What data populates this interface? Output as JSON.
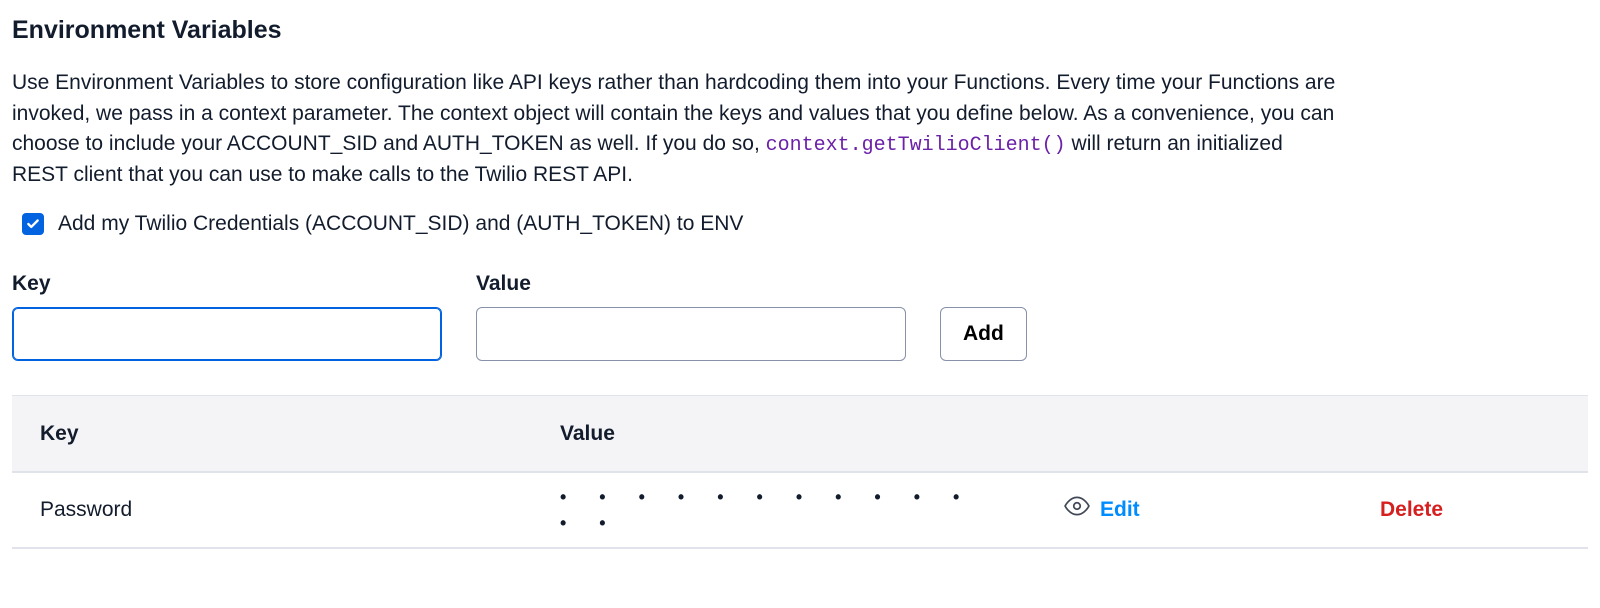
{
  "section": {
    "title": "Environment Variables",
    "description_before_code": "Use Environment Variables to store configuration like API keys rather than hardcoding them into your Functions. Every time your Functions are invoked, we pass in a context parameter. The context object will contain the keys and values that you define below. As a convenience, you can choose to include your ACCOUNT_SID and AUTH_TOKEN as well. If you do so, ",
    "code_snippet": "context.getTwilioClient()",
    "description_after_code": " will return an initialized REST client that you can use to make calls to the Twilio REST API.",
    "checkbox_label": "Add my Twilio Credentials (ACCOUNT_SID) and (AUTH_TOKEN) to ENV",
    "checkbox_checked": true
  },
  "form": {
    "key_label": "Key",
    "value_label": "Value",
    "key_value": "",
    "value_value": "",
    "add_button": "Add"
  },
  "table": {
    "columns": {
      "key": "Key",
      "value": "Value"
    },
    "rows": [
      {
        "key": "Password",
        "value_masked": "• • • • • • • • • • • • •",
        "edit_label": "Edit",
        "delete_label": "Delete"
      }
    ]
  }
}
